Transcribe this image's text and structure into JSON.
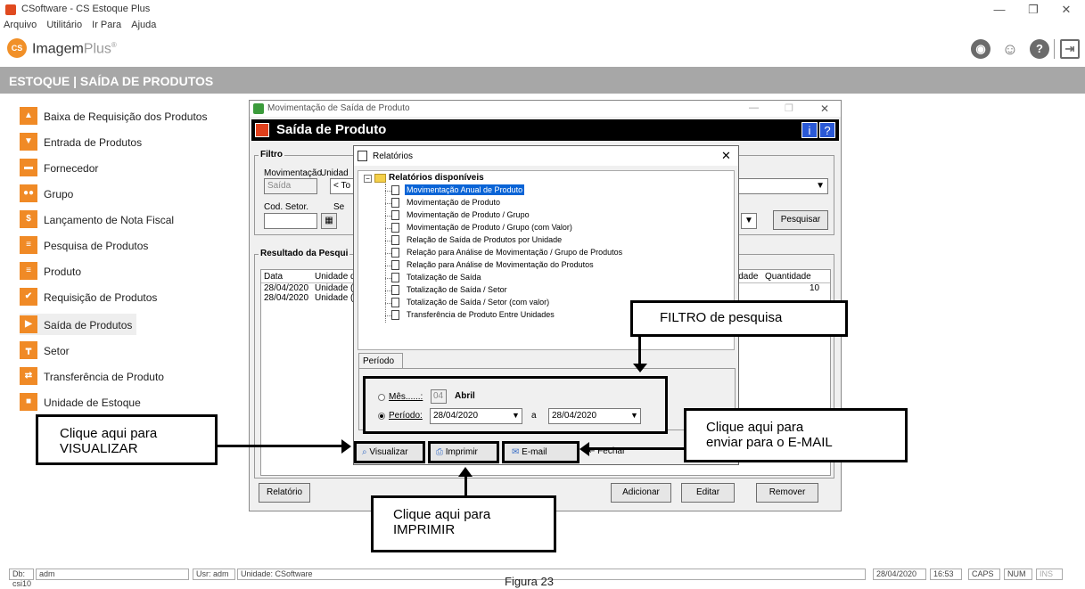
{
  "app": {
    "title": "CSoftware - CS Estoque Plus",
    "brand_main": "Imagem",
    "brand_accent": "Plus",
    "brand_mark": "®",
    "logo_text": "CS"
  },
  "window_controls": {
    "minimize": "—",
    "maximize": "❐",
    "close": "✕"
  },
  "menu": [
    "Arquivo",
    "Utilitário",
    "Ir Para",
    "Ajuda"
  ],
  "toolbar_icons": [
    "globe-icon",
    "user-icon",
    "help-icon",
    "exit-icon"
  ],
  "section_title": "ESTOQUE | SAÍDA DE PRODUTOS",
  "sidebar": {
    "items": [
      {
        "label": "Baixa de Requisição dos Produtos",
        "icon": "box-up-icon"
      },
      {
        "label": "Entrada de Produtos",
        "icon": "box-in-icon"
      },
      {
        "label": "Fornecedor",
        "icon": "truck-icon"
      },
      {
        "label": "Grupo",
        "icon": "group-icon"
      },
      {
        "label": "Lançamento de Nota Fiscal",
        "icon": "money-icon"
      },
      {
        "label": "Pesquisa de Produtos",
        "icon": "database-icon"
      },
      {
        "label": "Produto",
        "icon": "database-icon"
      },
      {
        "label": "Requisição de Produtos",
        "icon": "checklist-icon"
      },
      {
        "label": "Saída de Produtos",
        "icon": "box-out-icon"
      },
      {
        "label": "Setor",
        "icon": "org-icon"
      },
      {
        "label": "Transferência de Produto",
        "icon": "transfer-icon"
      },
      {
        "label": "Unidade de Estoque",
        "icon": "units-icon"
      }
    ]
  },
  "main_window": {
    "title": "Movimentação de Saída de Produto",
    "header": "Saída de Produto",
    "filter": {
      "group_label": "Filtro",
      "movimentacao_label": "Movimentação",
      "movimentacao_value": "Saída",
      "unidade_label": "Unidad",
      "unidade_value": "< To",
      "cod_setor_label": "Cod. Setor.",
      "setor_label": "Se",
      "search_button": "Pesquisar"
    },
    "results": {
      "group_label": "Resultado da Pesqui",
      "columns": [
        "Data",
        "Unidade d",
        "idade",
        "Quantidade"
      ],
      "rows": [
        {
          "data": "28/04/2020",
          "unidade": "Unidade (",
          "qty": "10"
        },
        {
          "data": "28/04/2020",
          "unidade": "Unidade (",
          "qty": ""
        }
      ]
    },
    "buttons": {
      "relatorio": "Relatório",
      "adicionar": "Adicionar",
      "editar": "Editar",
      "remover": "Remover"
    }
  },
  "dialog": {
    "title": "Relatórios",
    "tree_root": "Relatórios disponíveis",
    "reports": [
      "Movimentação Anual de Produto",
      "Movimentação de Produto",
      "Movimentação de Produto / Grupo",
      "Movimentação de Produto / Grupo (com Valor)",
      "Relação de Saída de Produtos por Unidade",
      "Relação para Análise de Movimentação / Grupo de Produtos",
      "Relação para Análise de Movimentação do Produtos",
      "Totalização de Saída",
      "Totalização de Saída / Setor",
      "Totalização de Saída / Setor (com valor)",
      "Transferência de Produto Entre Unidades"
    ],
    "tab": "Período",
    "mes_label": "Mês......:",
    "mes_value": "04",
    "mes_name": "Abril",
    "periodo_label": "Período:",
    "date_from": "28/04/2020",
    "date_sep": "a",
    "date_to": "28/04/2020",
    "buttons": {
      "visualizar": "Visualizar",
      "imprimir": "Imprimir",
      "email": "E-mail",
      "fechar": "Fechar"
    }
  },
  "annotations": {
    "filtro": "FILTRO de pesquisa",
    "visualizar": [
      "Clique aqui para",
      "VISUALIZAR"
    ],
    "email": [
      "Clique aqui para",
      "enviar para o E-MAIL"
    ],
    "imprimir": [
      "Clique aqui para",
      "IMPRIMIR"
    ]
  },
  "statusbar": {
    "db": "Db: csi10",
    "user_short": "adm",
    "usr": "Usr: adm",
    "unidade": "Unidade: CSoftware",
    "date": "28/04/2020",
    "time": "16:53",
    "caps": "CAPS",
    "num": "NUM",
    "ins": "INS"
  },
  "caption": "Figura 23"
}
